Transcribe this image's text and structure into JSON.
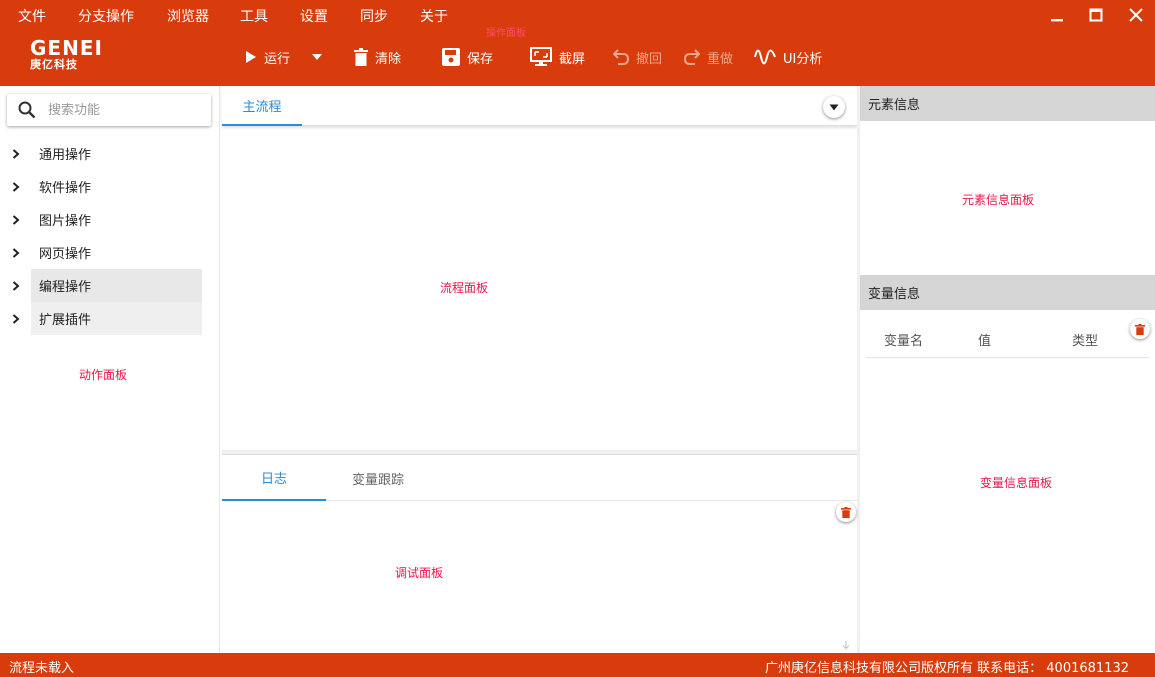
{
  "menu": [
    "文件",
    "分支操作",
    "浏览器",
    "工具",
    "设置",
    "同步",
    "关于"
  ],
  "toolbar_note": "操作面板",
  "logo": {
    "main": "GENEI",
    "sub": "庚亿科技"
  },
  "toolbar": {
    "run": "运行",
    "clear": "清除",
    "save": "保存",
    "screenshot": "截屏",
    "undo": "撤回",
    "redo": "重做",
    "ui_analysis": "UI分析"
  },
  "search": {
    "placeholder": "搜索功能"
  },
  "actions": [
    "通用操作",
    "软件操作",
    "图片操作",
    "网页操作",
    "编程操作",
    "扩展插件"
  ],
  "action_panel_label": "动作面板",
  "flow": {
    "tab": "主流程",
    "panel_label": "流程面板"
  },
  "debug": {
    "tabs": [
      "日志",
      "变量跟踪"
    ],
    "panel_label": "调试面板"
  },
  "element_info": {
    "title": "元素信息",
    "panel_label": "元素信息面板"
  },
  "variable_info": {
    "title": "变量信息",
    "columns": [
      "变量名",
      "值",
      "类型"
    ],
    "panel_label": "变量信息面板"
  },
  "status": {
    "left": "流程未载入",
    "right": "广州庚亿信息科技有限公司版权所有  联系电话： 4001681132"
  },
  "colors": {
    "brand": "#d83c0c",
    "accent": "#2a8bd8",
    "note": "#e8174a"
  }
}
